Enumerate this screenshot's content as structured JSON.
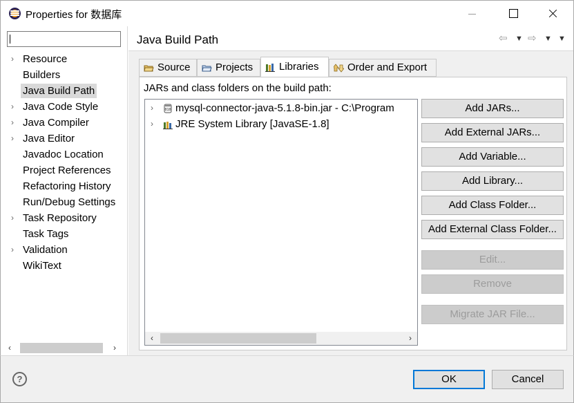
{
  "window": {
    "title": "Properties for 数据库",
    "icon": "eclipse-icon"
  },
  "nav": {
    "filter_value": "",
    "items": [
      {
        "label": "Resource",
        "expandable": true,
        "selected": false
      },
      {
        "label": "Builders",
        "expandable": false,
        "selected": false
      },
      {
        "label": "Java Build Path",
        "expandable": false,
        "selected": true
      },
      {
        "label": "Java Code Style",
        "expandable": true,
        "selected": false
      },
      {
        "label": "Java Compiler",
        "expandable": true,
        "selected": false
      },
      {
        "label": "Java Editor",
        "expandable": true,
        "selected": false
      },
      {
        "label": "Javadoc Location",
        "expandable": false,
        "selected": false
      },
      {
        "label": "Project References",
        "expandable": false,
        "selected": false
      },
      {
        "label": "Refactoring History",
        "expandable": false,
        "selected": false
      },
      {
        "label": "Run/Debug Settings",
        "expandable": false,
        "selected": false
      },
      {
        "label": "Task Repository",
        "expandable": true,
        "selected": false
      },
      {
        "label": "Task Tags",
        "expandable": false,
        "selected": false
      },
      {
        "label": "Validation",
        "expandable": true,
        "selected": false
      },
      {
        "label": "WikiText",
        "expandable": false,
        "selected": false
      }
    ]
  },
  "panel": {
    "title": "Java Build Path",
    "tabs": [
      {
        "label": "Source",
        "icon": "source-folder-icon",
        "active": false
      },
      {
        "label": "Projects",
        "icon": "projects-icon",
        "active": false
      },
      {
        "label": "Libraries",
        "icon": "libraries-icon",
        "active": true
      },
      {
        "label": "Order and Export",
        "icon": "order-export-icon",
        "active": false
      }
    ],
    "section_label": "JARs and class folders on the build path:",
    "entries": [
      {
        "label": "mysql-connector-java-5.1.8-bin.jar - C:\\Program",
        "icon": "jar-icon"
      },
      {
        "label": "JRE System Library [JavaSE-1.8]",
        "icon": "library-icon"
      }
    ],
    "buttons": [
      {
        "label": "Add JARs...",
        "enabled": true
      },
      {
        "label": "Add External JARs...",
        "enabled": true
      },
      {
        "label": "Add Variable...",
        "enabled": true
      },
      {
        "label": "Add Library...",
        "enabled": true
      },
      {
        "label": "Add Class Folder...",
        "enabled": true
      },
      {
        "label": "Add External Class Folder...",
        "enabled": true
      },
      {
        "label": "Edit...",
        "enabled": false
      },
      {
        "label": "Remove",
        "enabled": false
      },
      {
        "label": "Migrate JAR File...",
        "enabled": false
      }
    ]
  },
  "footer": {
    "ok_label": "OK",
    "cancel_label": "Cancel"
  },
  "colors": {
    "default_button_border": "#0078d7",
    "selection_bg": "#d9d9d9",
    "disabled_text": "#9c9c9c"
  }
}
